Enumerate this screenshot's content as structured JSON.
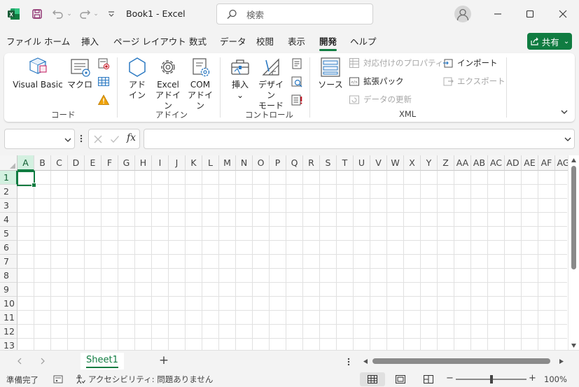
{
  "titlebar": {
    "doc_title": "Book1  -  Excel",
    "search_placeholder": "検索",
    "logo_letter": "X"
  },
  "menu": {
    "tabs": [
      "ファイル",
      "ホーム",
      "挿入",
      "ページ レイアウト",
      "数式",
      "データ",
      "校閲",
      "表示",
      "開発",
      "ヘルプ"
    ],
    "active_tab": "開発",
    "share_label": "共有"
  },
  "ribbon": {
    "code": {
      "label": "コード",
      "visual_basic": "Visual Basic",
      "macro": "マクロ"
    },
    "addins": {
      "label": "アドイン",
      "addin_line1": "アド",
      "addin_line2": "イン",
      "excel_addin_line1": "Excel",
      "excel_addin_line2": "アドイン",
      "com_addin_line1": "COM",
      "com_addin_line2": "アドイン"
    },
    "controls": {
      "label": "コントロール",
      "insert": "挿入",
      "insert_caret": "⌄",
      "design_mode_line1": "デザイン",
      "design_mode_line2": "モード"
    },
    "xml": {
      "label": "XML",
      "source": "ソース",
      "map_properties": "対応付けのプロパティ",
      "expansion_packs": "拡張パック",
      "refresh_data": "データの更新",
      "import": "インポート",
      "export": "エクスポート"
    }
  },
  "formula_bar": {
    "fx": "fx"
  },
  "grid": {
    "columns": [
      "A",
      "B",
      "C",
      "D",
      "E",
      "F",
      "G",
      "H",
      "I",
      "J",
      "K",
      "L",
      "M",
      "N",
      "O",
      "P",
      "Q",
      "R",
      "S",
      "T",
      "U",
      "V",
      "W",
      "X",
      "Y",
      "Z",
      "AA",
      "AB",
      "AC",
      "AD",
      "AE",
      "AF",
      "AG"
    ],
    "rows": [
      "1",
      "2",
      "3",
      "4",
      "5",
      "6",
      "7",
      "8",
      "9",
      "10",
      "11",
      "12",
      "13"
    ],
    "selected_cell": "A1"
  },
  "sheets": {
    "tabs": [
      "Sheet1"
    ],
    "add_label": "+"
  },
  "status": {
    "ready": "準備完了",
    "accessibility": "アクセシビリティ: 問題ありません",
    "zoom_minus": "−",
    "zoom_plus": "+",
    "zoom_value": "100%",
    "zoom_level": 1.0
  },
  "colors": {
    "accent": "#107c41",
    "warning": "#f0a30a",
    "icon_blue": "#2b79c2"
  }
}
